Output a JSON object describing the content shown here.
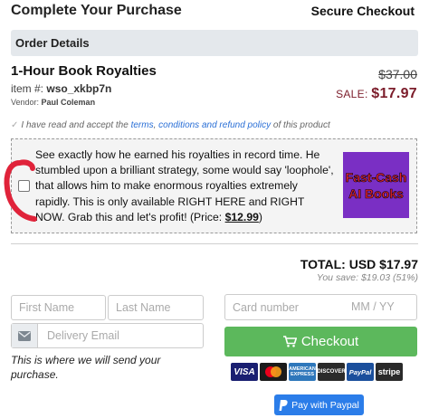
{
  "header": {
    "title": "Complete Your Purchase",
    "secure_label": "Secure Checkout"
  },
  "order_details": {
    "label": "Order Details"
  },
  "product": {
    "name": "1-Hour Book Royalties",
    "item_prefix": "item #:",
    "item_id": "wso_xkbp7n",
    "vendor_prefix": "Vendor:",
    "vendor_name": "Paul Coleman",
    "original_price": "$37.00",
    "sale_label": "SALE:",
    "sale_price": "$17.97"
  },
  "terms": {
    "pre": "I have read and accept the",
    "link1": "terms",
    "sep": ",",
    "link2": "conditions and refund policy",
    "post": "of this product"
  },
  "order_bump": {
    "text": "See exactly how he earned his royalties in record time. He stumbled upon a brilliant strategy, some would say 'loophole', that allows him to make enormous royalties extremely rapidly. This is only available RIGHT HERE and RIGHT NOW. Grab this and let's profit! (Price: ",
    "price": "$12.99",
    "text_end": ")",
    "checked": false,
    "image_text": "Fast-Cash AI Books",
    "image_bg": "#7a2fc4",
    "image_text_color": "#e8232e",
    "annotation_color": "#e0233a"
  },
  "totals": {
    "total": "TOTAL:  USD $17.97",
    "savings": "You save: $19.03 (51%)"
  },
  "form": {
    "first_name_placeholder": "First Name",
    "last_name_placeholder": "Last Name",
    "email_placeholder": "Delivery Email",
    "email_note": "This is where we will send your purchase.",
    "card_placeholder": "Card number",
    "expiry_placeholder": "MM / YY"
  },
  "buttons": {
    "checkout": "Checkout",
    "paypal": "Pay with Paypal"
  },
  "payment_icons": [
    "VISA",
    "mastercard",
    "AMERICAN EXPRESS",
    "DISCOVER",
    "PayPal",
    "stripe"
  ],
  "colors": {
    "checkout_green": "#5cb85c",
    "paypal_blue": "#2b7de9",
    "sale_red": "#7b1c2a",
    "link_blue": "#2a6fd6"
  }
}
